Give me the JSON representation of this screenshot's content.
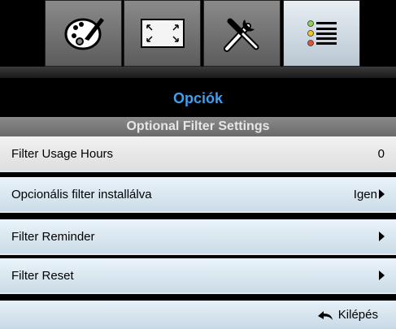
{
  "tabs": [
    {
      "icon": "display-palette-icon",
      "active": false
    },
    {
      "icon": "screen-resize-icon",
      "active": false
    },
    {
      "icon": "setup-tools-icon",
      "active": false
    },
    {
      "icon": "options-list-icon",
      "active": true
    }
  ],
  "header": {
    "title": "Opciók",
    "subtitle": "Optional Filter Settings"
  },
  "rows": [
    {
      "label": "Filter Usage Hours",
      "value": "0",
      "arrow": false
    },
    {
      "label": "Opcionális filter installálva",
      "value": "Igen",
      "arrow": true
    },
    {
      "label": "Filter Reminder",
      "value": "",
      "arrow": true
    },
    {
      "label": "Filter Reset",
      "value": "",
      "arrow": true
    }
  ],
  "footer": {
    "exit_label": "Kilépés",
    "icon": "back-arrow-icon"
  },
  "colors": {
    "accent": "#3ea0f0",
    "subtitle_bg": "#7a7a7a",
    "row_bg": "#d8e6f0"
  }
}
